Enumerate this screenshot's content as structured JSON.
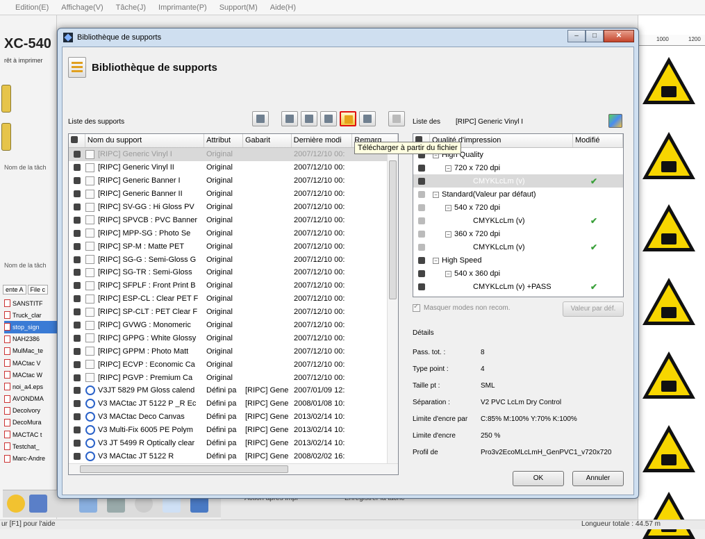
{
  "app": {
    "menu": [
      "Edition(E)",
      "Affichage(V)",
      "Tâche(J)",
      "Imprimante(P)",
      "Support(M)",
      "Aide(H)"
    ],
    "printer_title": "XC-540",
    "printer_status": "rêt à imprimer",
    "task_name_label_1": "Nom de la tâch",
    "task_name_label_2": "Nom de la tâch",
    "tab_a": "ente A",
    "tab_b": "File c",
    "files": [
      "SANSTITF",
      "Truck_clar",
      "stop_sign",
      "NAH2386",
      "MulMac_te",
      "MACtac V",
      "MACtac W",
      "noi_a4.eps",
      "AVONDMA",
      "Decolvory",
      "DecoMura",
      "MACTAC t",
      "Testchat_",
      "Marc-Andre"
    ],
    "bottom_text_1": "Action après impr",
    "bottom_text_2": "Enregistrer la tâche",
    "status_left": "ur [F1] pour l'aide",
    "status_right": "Longueur totale : 44.57 m",
    "ruler": [
      "1000",
      "1200"
    ]
  },
  "dialog": {
    "title": "Bibliothèque de supports",
    "header": "Bibliothèque de supports",
    "controls": {
      "minimize": "–",
      "maximize": "□",
      "close": "✕"
    },
    "list_label": "Liste des supports",
    "tooltip": "Télécharger à partir du fichier",
    "columns": [
      "",
      "Nom du support",
      "Attribut",
      "Gabarit",
      "Dernière modi",
      "Remarq"
    ],
    "media": [
      {
        "name": "[RIPC] Generic Vinyl I",
        "attr": "Original",
        "gabarit": "",
        "date": "2007/12/10 00:",
        "custom": false,
        "selected": true
      },
      {
        "name": "[RIPC] Generic Vinyl II",
        "attr": "Original",
        "gabarit": "",
        "date": "2007/12/10 00:",
        "custom": false
      },
      {
        "name": "[RIPC] Generic Banner I",
        "attr": "Original",
        "gabarit": "",
        "date": "2007/12/10 00:",
        "custom": false
      },
      {
        "name": "[RIPC] Generic Banner II",
        "attr": "Original",
        "gabarit": "",
        "date": "2007/12/10 00:",
        "custom": false
      },
      {
        "name": "[RIPC] SV-GG : Hi Gloss PV",
        "attr": "Original",
        "gabarit": "",
        "date": "2007/12/10 00:",
        "custom": false
      },
      {
        "name": "[RIPC] SPVCB : PVC Banner",
        "attr": "Original",
        "gabarit": "",
        "date": "2007/12/10 00:",
        "custom": false
      },
      {
        "name": "[RIPC] MPP-SG : Photo Se",
        "attr": "Original",
        "gabarit": "",
        "date": "2007/12/10 00:",
        "custom": false
      },
      {
        "name": "[RIPC] SP-M : Matte PET",
        "attr": "Original",
        "gabarit": "",
        "date": "2007/12/10 00:",
        "custom": false
      },
      {
        "name": "[RIPC] SG-G : Semi-Gloss G",
        "attr": "Original",
        "gabarit": "",
        "date": "2007/12/10 00:",
        "custom": false
      },
      {
        "name": "[RIPC] SG-TR : Semi-Gloss",
        "attr": "Original",
        "gabarit": "",
        "date": "2007/12/10 00:",
        "custom": false
      },
      {
        "name": "[RIPC] SFPLF : Front Print B",
        "attr": "Original",
        "gabarit": "",
        "date": "2007/12/10 00:",
        "custom": false
      },
      {
        "name": "[RIPC] ESP-CL : Clear PET F",
        "attr": "Original",
        "gabarit": "",
        "date": "2007/12/10 00:",
        "custom": false
      },
      {
        "name": "[RIPC] SP-CLT : PET Clear F",
        "attr": "Original",
        "gabarit": "",
        "date": "2007/12/10 00:",
        "custom": false
      },
      {
        "name": "[RIPC] GVWG : Monomeric",
        "attr": "Original",
        "gabarit": "",
        "date": "2007/12/10 00:",
        "custom": false
      },
      {
        "name": "[RIPC] GPPG : White Glossy",
        "attr": "Original",
        "gabarit": "",
        "date": "2007/12/10 00:",
        "custom": false
      },
      {
        "name": "[RIPC] GPPM : Photo Matt",
        "attr": "Original",
        "gabarit": "",
        "date": "2007/12/10 00:",
        "custom": false
      },
      {
        "name": "[RIPC] ECVP : Economic Ca",
        "attr": "Original",
        "gabarit": "",
        "date": "2007/12/10 00:",
        "custom": false
      },
      {
        "name": "[RIPC] PGVP : Premium Ca",
        "attr": "Original",
        "gabarit": "",
        "date": "2007/12/10 00:",
        "custom": false
      },
      {
        "name": "V3JT 5829 PM Gloss calend",
        "attr": "Défini pa",
        "gabarit": "[RIPC] Gene",
        "date": "2007/01/09 12:",
        "custom": true
      },
      {
        "name": "V3 MACtac JT 5122 P _R Ec",
        "attr": "Défini pa",
        "gabarit": "[RIPC] Gene",
        "date": "2008/01/08 10:",
        "custom": true
      },
      {
        "name": "V3 MACtac Deco Canvas",
        "attr": "Défini pa",
        "gabarit": "[RIPC] Gene",
        "date": "2013/02/14 10:",
        "custom": true
      },
      {
        "name": "V3 Multi-Fix 6005 PE Polym",
        "attr": "Défini pa",
        "gabarit": "[RIPC] Gene",
        "date": "2013/02/14 10:",
        "custom": true
      },
      {
        "name": "V3 JT 5499 R Optically clear",
        "attr": "Défini pa",
        "gabarit": "[RIPC] Gene",
        "date": "2013/02/14 10:",
        "custom": true
      },
      {
        "name": "V3 MACtac JT 5122 R",
        "attr": "Défini pa",
        "gabarit": "[RIPC] Gene",
        "date": "2008/02/02 16:",
        "custom": true
      }
    ],
    "right_label": "Liste des",
    "right_media": "[RIPC] Generic Vinyl I",
    "quality_columns": [
      "",
      "Qualité d'impression",
      "Modifié"
    ],
    "quality_rows": [
      {
        "label": "High Quality",
        "level": 0,
        "mod": "",
        "dim": false
      },
      {
        "label": "720 x 720 dpi",
        "level": 1,
        "mod": "",
        "dim": false
      },
      {
        "label": "CMYKLcLm (v)",
        "level": 2,
        "mod": "✔",
        "dim": false,
        "selected": true
      },
      {
        "label": "Standard(Valeur par défaut)",
        "level": 0,
        "mod": "",
        "dim": true
      },
      {
        "label": "540 x 720 dpi",
        "level": 1,
        "mod": "",
        "dim": true
      },
      {
        "label": "CMYKLcLm (v)",
        "level": 2,
        "mod": "✔",
        "dim": true
      },
      {
        "label": "360 x 720 dpi",
        "level": 1,
        "mod": "",
        "dim": true
      },
      {
        "label": "CMYKLcLm (v)",
        "level": 2,
        "mod": "✔",
        "dim": true
      },
      {
        "label": "High Speed",
        "level": 0,
        "mod": "",
        "dim": false
      },
      {
        "label": "540 x 360 dpi",
        "level": 1,
        "mod": "",
        "dim": false
      },
      {
        "label": "CMYKLcLm (v) +PASS",
        "level": 2,
        "mod": "✔",
        "dim": false
      }
    ],
    "mask_label": "Masquer modes non recom.",
    "default_button": "Valeur par déf.",
    "details_title": "Détails",
    "details": [
      {
        "k": "Pass. tot. :",
        "v": "8"
      },
      {
        "k": "Type point :",
        "v": "4"
      },
      {
        "k": "Taille pt :",
        "v": "SML"
      },
      {
        "k": "Séparation :",
        "v": "V2 PVC LcLm Dry Control"
      },
      {
        "k": "Limite d'encre par",
        "v": "C:85% M:100% Y:70% K:100%"
      },
      {
        "k": "Limite d'encre",
        "v": "250 %"
      },
      {
        "k": "Profil de",
        "v": "Pro3v2EcoMLcLmH_GenPVC1_v720x720"
      }
    ],
    "ok": "OK",
    "cancel": "Annuler"
  }
}
